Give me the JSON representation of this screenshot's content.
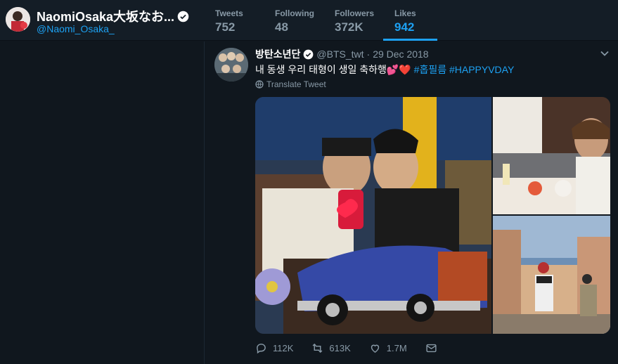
{
  "profile": {
    "name": "NaomiOsaka大坂なお...",
    "handle": "@Naomi_Osaka_"
  },
  "stats": [
    {
      "label": "Tweets",
      "value": "752"
    },
    {
      "label": "Following",
      "value": "48"
    },
    {
      "label": "Followers",
      "value": "372K"
    },
    {
      "label": "Likes",
      "value": "942"
    }
  ],
  "tweet": {
    "author": "방탄소년단",
    "handle": "@BTS_twt",
    "separator": "·",
    "date": "29 Dec 2018",
    "text": "내 동생 우리 태형이 생일 축하행💕❤️",
    "hashtags": "#홉필름 #HAPPYVDAY",
    "translate": "Translate Tweet",
    "replies": "112K",
    "retweets": "613K",
    "likes": "1.7M"
  },
  "colors": {
    "accent": "#1da1f2",
    "background": "#10171e",
    "header": "#141d26",
    "muted": "#8899a6"
  }
}
